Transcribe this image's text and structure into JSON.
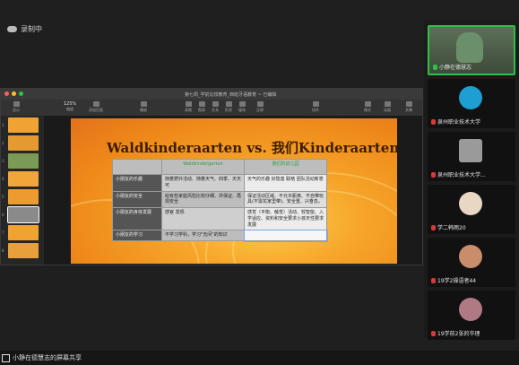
{
  "meeting": {
    "status_text": "录制中",
    "share_label": "小静在德慧志的屏幕共享"
  },
  "keynote": {
    "window_title": "第七周_学前比较教育_西班牙语教育 ~ 已编辑",
    "toolbar": [
      "显示",
      "缩放",
      "添加页面",
      "播放",
      "表格",
      "图表",
      "文本",
      "形状",
      "媒体",
      "注释",
      "协作",
      "格式",
      "动画",
      "文稿"
    ],
    "zoom": "125%",
    "slide_numbers": [
      "1",
      "2",
      "3",
      "4",
      "5",
      "6",
      "7",
      "8",
      "9",
      "10"
    ]
  },
  "slide": {
    "title": "Waldkinderaarten vs. 我们Kinderaarten",
    "table": {
      "headers": [
        "",
        "Waldkindergarten",
        "我们的幼儿园"
      ],
      "rows": [
        {
          "label": "小朋友的乐趣",
          "c1": "随着野外活动、随着天气、四季、天天可",
          "c2": "天气的乐趣 好隐患 联络 团队活动新意"
        },
        {
          "label": "小朋友的安全",
          "c1": "给有些家庭风险比较仔细、并保证、再现安全",
          "c2": "保证活动区域、不允许距离、不自带玩具(不需花家里带)、安全重、兴奋息。"
        },
        {
          "label": "小朋友的身体发展",
          "c1": "感官 发现",
          "c2": "感觉（平衡、触觉）活动、较智能、入学适应、资料和安全要求小孩天性要求发展"
        },
        {
          "label": "小朋友的学习",
          "c1": "不学习学科，学习\"无间\"的知识",
          "c2": ""
        }
      ]
    }
  },
  "participants": [
    {
      "name": "小静在德慧志",
      "mic": "on",
      "avatar_color": "#6b8f6a"
    },
    {
      "name": "泉州职业技术大学",
      "mic": "muted",
      "avatar_color": "#1e9fd3"
    },
    {
      "name": "泉州职业技术大学...",
      "mic": "muted",
      "avatar_color": "#9a9a9a"
    },
    {
      "name": "学二韩雨20",
      "mic": "muted",
      "avatar_color": "#e8d7c3"
    },
    {
      "name": "19学2操语者44",
      "mic": "muted",
      "avatar_color": "#c98d6b"
    },
    {
      "name": "19学前2张的华理",
      "mic": "muted",
      "avatar_color": "#b07a85"
    }
  ],
  "icons": {
    "status": "cloud-record-icon",
    "mic": "mic-icon",
    "share": "screen-share-icon"
  },
  "colors": {
    "green": "#2fbf47",
    "red": "#d83a3a",
    "slide_orange": "#f6a52a"
  }
}
